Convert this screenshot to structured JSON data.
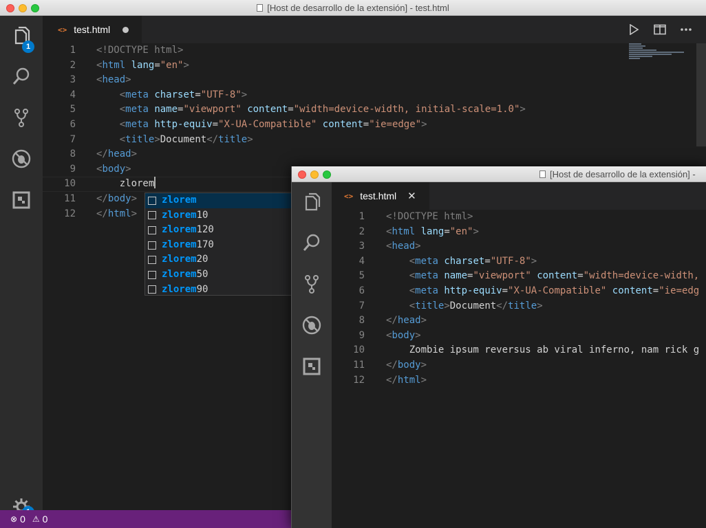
{
  "win1": {
    "title": "[Host de desarrollo de la extensión] - test.html",
    "tab": {
      "icon": "<>",
      "name": "test.html"
    },
    "explorer_badge": "1",
    "settings_badge": "1",
    "status": {
      "errors": "0",
      "warnings": "0"
    },
    "suggestions": {
      "typed": "zlorem",
      "items": [
        {
          "match": "zlorem",
          "rest": ""
        },
        {
          "match": "zlorem",
          "rest": "10"
        },
        {
          "match": "zlorem",
          "rest": "120"
        },
        {
          "match": "zlorem",
          "rest": "170"
        },
        {
          "match": "zlorem",
          "rest": "20"
        },
        {
          "match": "zlorem",
          "rest": "50"
        },
        {
          "match": "zlorem",
          "rest": "90"
        }
      ]
    }
  },
  "win2": {
    "title": "[Host de desarrollo de la extensión] -",
    "tab": {
      "icon": "<>",
      "name": "test.html"
    },
    "body_text": "Zombie ipsum reversus ab viral inferno, nam rick g"
  },
  "line_numbers": [
    "1",
    "2",
    "3",
    "4",
    "5",
    "6",
    "7",
    "8",
    "9",
    "10",
    "11",
    "12"
  ],
  "code": {
    "doctype": "<!DOCTYPE html>",
    "lt": "<",
    "gt": ">",
    "lt_slash": "</",
    "eq": "=",
    "html": "html",
    "head": "head",
    "meta": "meta",
    "title": "title",
    "body": "body",
    "lang": "lang",
    "lang_val": "\"en\"",
    "charset": "charset",
    "charset_val": "\"UTF-8\"",
    "name": "name",
    "name_val": "\"viewport\"",
    "content": "content",
    "content_val1": "\"width=device-width, initial-scale=1.0\"",
    "content_val2_partial": "\"width=device-width,",
    "http_equiv": "http-equiv",
    "http_equiv_val": "\"X-UA-Compatible\"",
    "content_val3": "\"ie=edge\"",
    "content_val3_partial": "\"ie=edg",
    "document": "Document"
  },
  "icons": [
    "files-icon",
    "search-icon",
    "source-control-icon",
    "debug-icon",
    "extensions-icon",
    "gear-icon",
    "play-icon",
    "split-editor-icon",
    "more-icon"
  ],
  "colors": {
    "status_bar": "#68217a",
    "badge": "#007acc",
    "tag": "#569cd6",
    "attr": "#9cdcfe",
    "string": "#ce9178"
  }
}
